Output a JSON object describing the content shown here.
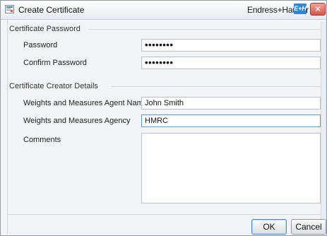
{
  "window": {
    "title": "Create Certificate",
    "brand": "Endress+Hauser",
    "brand_logo": "E+H",
    "close_glyph": "✕"
  },
  "password_section": {
    "title": "Certificate Password",
    "password_label": "Password",
    "password_value": "••••••••",
    "confirm_label": "Confirm Password",
    "confirm_value": "••••••••"
  },
  "creator_section": {
    "title": "Certificate Creator Details",
    "agent_label": "Weights and Measures Agent Name",
    "agent_value": "John Smith",
    "agency_label": "Weights and Measures Agency",
    "agency_value": "HMRC",
    "comments_label": "Comments",
    "comments_value": ""
  },
  "buttons": {
    "ok": "OK",
    "cancel": "Cancel"
  },
  "colors": {
    "accent": "#2f86d6",
    "close": "#d9574a"
  }
}
